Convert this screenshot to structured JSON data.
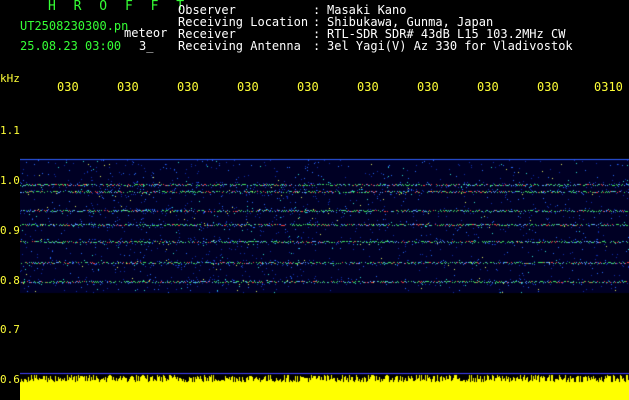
{
  "header": {
    "brand": "H R O F F T",
    "filename": "UT2508230300.pn",
    "filename_suffix": "meteor",
    "datetime": "25.08.23 03:00",
    "datetime_extra": "3_",
    "info_rows": [
      {
        "label": "Observer",
        "sep": ":",
        "value": "Masaki Kano"
      },
      {
        "label": "Receiving Location",
        "sep": ":",
        "value": "Shibukawa, Gunma, Japan"
      },
      {
        "label": "Receiver",
        "sep": ":",
        "value": "RTL-SDR SDR# 43dB L15 103.2MHz CW"
      },
      {
        "label": "Receiving Antenna",
        "sep": ":",
        "value": "3el Yagi(V) Az 330 for Vladivostok"
      }
    ]
  },
  "axes": {
    "y_unit": "kHz",
    "y_ticks": [
      "1.1",
      "1.0",
      "0.9",
      "0.8",
      "0.7",
      "0.6"
    ],
    "x_ticks": [
      "030",
      "030",
      "030",
      "030",
      "030",
      "030",
      "030",
      "030",
      "030"
    ],
    "x_last": "0310"
  },
  "colors": {
    "background": "#000000",
    "header_green": "#35ff35",
    "axis_yellow": "#ffff37",
    "level_bar": "#ffff00"
  }
}
